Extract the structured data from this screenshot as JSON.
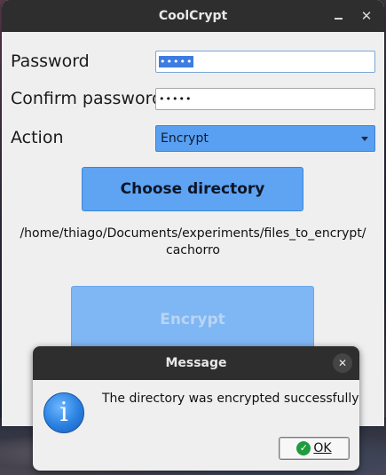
{
  "window": {
    "title": "CoolCrypt",
    "minimize_icon": "minimize-icon",
    "close_glyph": "✕"
  },
  "form": {
    "password_label": "Password",
    "password_value": "•••••",
    "confirm_label": "Confirm password",
    "confirm_value": "•••••",
    "action_label": "Action",
    "action_selected": "Encrypt",
    "choose_button": "Choose directory",
    "path_line1": "/home/thiago/Documents/experiments/files_to_encrypt/",
    "path_line2": "cachorro",
    "encrypt_button": "Encrypt"
  },
  "dialog": {
    "title": "Message",
    "close_glyph": "✕",
    "icon": "info-icon",
    "icon_glyph": "i",
    "message": "The directory was encrypted successfully",
    "ok_label": "OK",
    "ok_icon_glyph": "✓"
  },
  "colors": {
    "accent": "#5fa3f3",
    "titlebar": "#2e2e2e",
    "ok_check": "#1e9c3e"
  }
}
